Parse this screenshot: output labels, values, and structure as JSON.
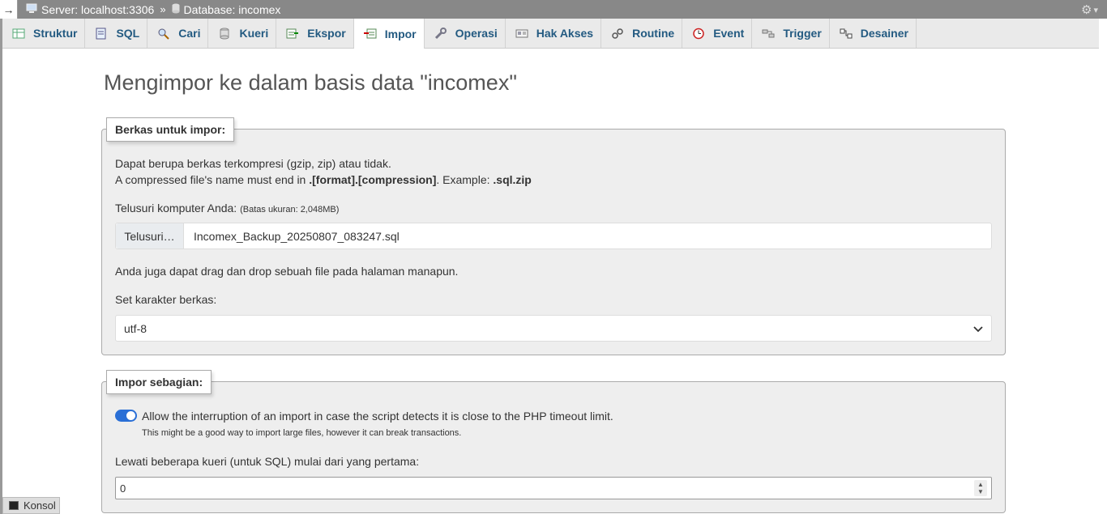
{
  "breadcrumb": {
    "collapse_glyph": "→",
    "server_label": "Server: localhost:3306",
    "separator": "»",
    "database_label": "Database: incomex"
  },
  "tabs": [
    {
      "label": "Struktur",
      "icon": "structure-icon"
    },
    {
      "label": "SQL",
      "icon": "sql-icon"
    },
    {
      "label": "Cari",
      "icon": "search-icon"
    },
    {
      "label": "Kueri",
      "icon": "query-icon"
    },
    {
      "label": "Ekspor",
      "icon": "export-icon"
    },
    {
      "label": "Impor",
      "icon": "import-icon",
      "active": true
    },
    {
      "label": "Operasi",
      "icon": "wrench-icon"
    },
    {
      "label": "Hak Akses",
      "icon": "privileges-icon"
    },
    {
      "label": "Routine",
      "icon": "routine-icon"
    },
    {
      "label": "Event",
      "icon": "clock-icon"
    },
    {
      "label": "Trigger",
      "icon": "trigger-icon"
    },
    {
      "label": "Desainer",
      "icon": "designer-icon"
    }
  ],
  "page": {
    "title": "Mengimpor ke dalam basis data \"incomex\""
  },
  "file_section": {
    "legend": "Berkas untuk impor:",
    "desc1": "Dapat berupa berkas terkompresi (gzip, zip) atau tidak.",
    "desc2_prefix": "A compressed file's name must end in ",
    "desc2_format": ".[format].[compression]",
    "desc2_mid": ". Example: ",
    "desc2_example": ".sql.zip",
    "browse_label": "Telusuri komputer Anda:",
    "size_limit": "(Batas ukuran: 2,048MB)",
    "browse_button": "Telusuri…",
    "file_name": "Incomex_Backup_20250807_083247.sql",
    "drag_hint": "Anda juga dapat drag dan drop sebuah file pada halaman manapun.",
    "charset_label": "Set karakter berkas:",
    "charset_value": "utf-8"
  },
  "partial_section": {
    "legend": "Impor sebagian:",
    "toggle_on": true,
    "allow_interrupt": "Allow the interruption of an import in case the script detects it is close to the PHP timeout limit.",
    "interrupt_hint": "This might be a good way to import large files, however it can break transactions.",
    "skip_label": "Lewati beberapa kueri (untuk SQL) mulai dari yang pertama:",
    "skip_value": "0"
  },
  "console": {
    "label": "Konsol"
  },
  "colors": {
    "accent": "#235a81",
    "toggle": "#2a6fd6",
    "topbar": "#888888"
  }
}
